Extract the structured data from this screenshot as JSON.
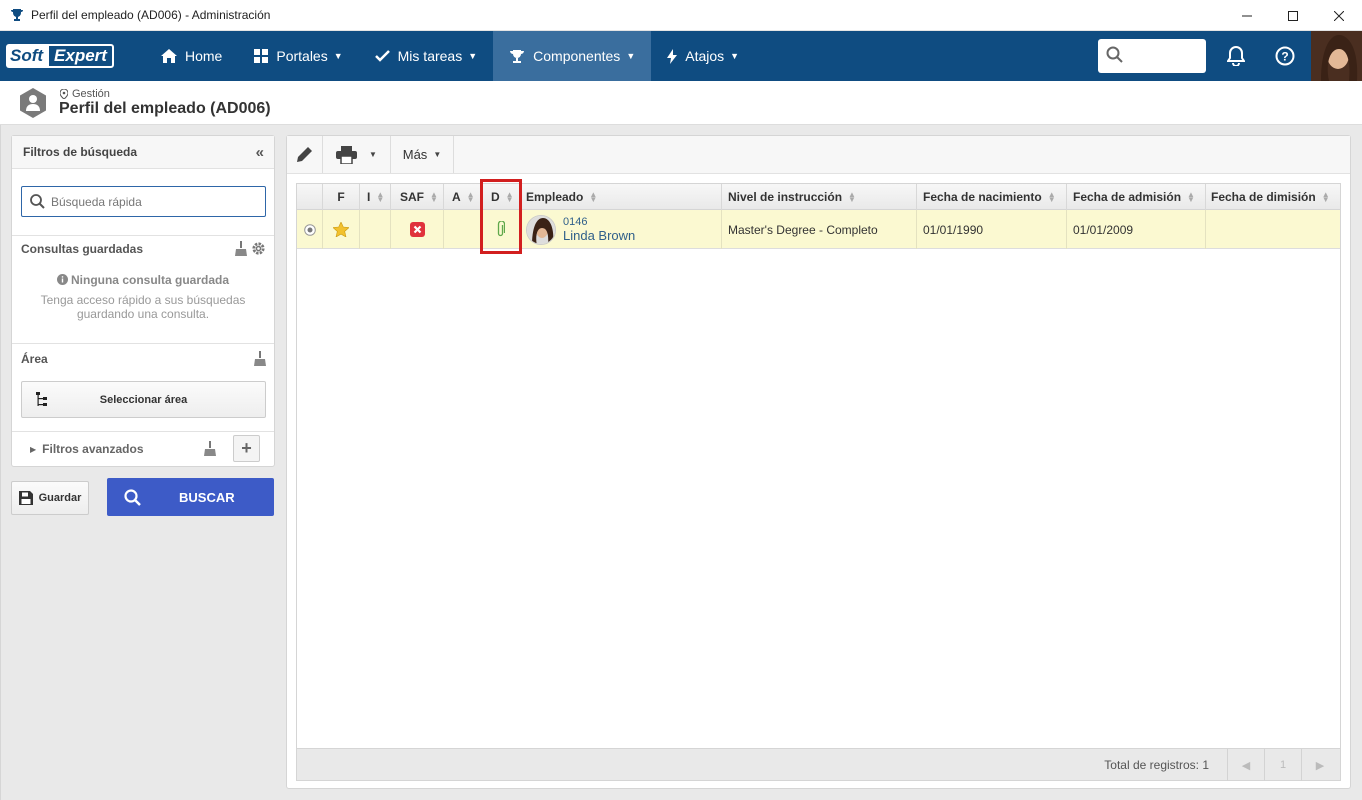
{
  "window": {
    "title": "Perfil del empleado (AD006) - Administración"
  },
  "topnav": {
    "logo_soft": "Soft",
    "logo_expert": "Expert",
    "items": [
      {
        "label": "Home",
        "icon": "home-icon"
      },
      {
        "label": "Portales",
        "icon": "portal-icon"
      },
      {
        "label": "Mis tareas",
        "icon": "check-icon"
      },
      {
        "label": "Componentes",
        "icon": "trophy-icon"
      },
      {
        "label": "Atajos",
        "icon": "bolt-icon"
      }
    ],
    "search_placeholder": ""
  },
  "breadcrumb": {
    "parent": "Gestión",
    "title": "Perfil del empleado (AD006)"
  },
  "filters": {
    "header": "Filtros de búsqueda",
    "quick_search_placeholder": "Búsqueda rápida",
    "saved_header": "Consultas guardadas",
    "no_saved": "Ninguna consulta guardada",
    "no_saved_desc": "Tenga acceso rápido a sus búsquedas guardando una consulta.",
    "area_header": "Área",
    "select_area": "Seleccionar área",
    "advanced": "Filtros avanzados",
    "save_btn": "Guardar",
    "search_btn": "BUSCAR"
  },
  "toolbar": {
    "more": "Más"
  },
  "grid": {
    "columns": [
      "F",
      "I",
      "SAF",
      "A",
      "D",
      "Empleado",
      "Nivel de instrucción",
      "Fecha de nacimiento",
      "Fecha de admisión",
      "Fecha de dimisión"
    ],
    "rows": [
      {
        "employee_id": "0146",
        "employee_name": "Linda Brown",
        "education": "Master's Degree - Completo",
        "birth": "01/01/1990",
        "admission": "01/01/2009",
        "dismissal": ""
      }
    ],
    "total_label": "Total de registros: 1",
    "page": "1"
  },
  "colors": {
    "nav": "#0f4c81",
    "nav_active": "#3a6e9e",
    "buscar": "#3d5bc7",
    "row_highlight": "#fbf9d1",
    "annotation": "#d21f1f"
  }
}
